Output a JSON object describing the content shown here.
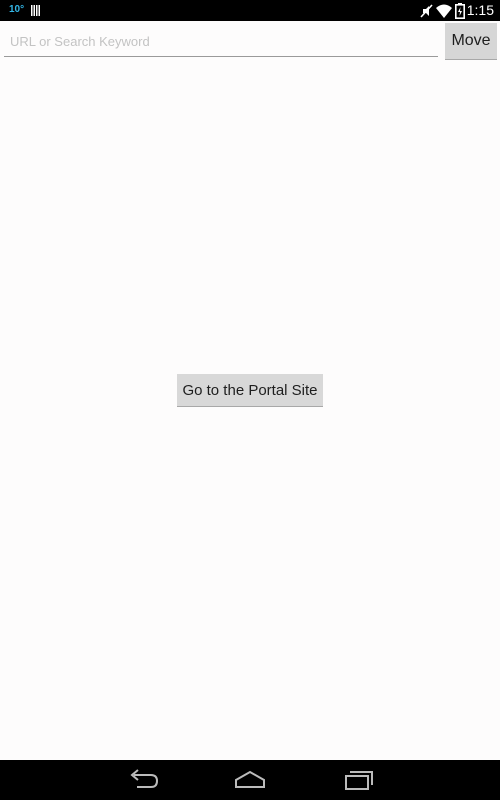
{
  "status_bar": {
    "temperature": "10°",
    "time": "1:15",
    "icons": [
      "storage-bars-icon",
      "muted-icon",
      "wifi-icon",
      "battery-icon"
    ],
    "temperature_color": "#33b5e5"
  },
  "browser": {
    "url_placeholder": "URL or Search Keyword",
    "url_value": "",
    "move_label": "Move"
  },
  "main": {
    "portal_label": "Go to the Portal Site"
  },
  "nav_bar": {
    "icons": [
      "back-icon",
      "home-icon",
      "recents-icon"
    ]
  }
}
